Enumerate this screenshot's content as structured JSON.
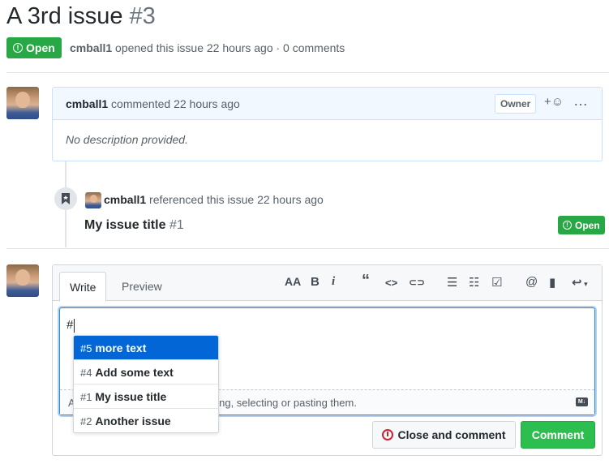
{
  "issue": {
    "title": "A 3rd issue",
    "number": "#3",
    "state": "Open",
    "author": "cmball1",
    "meta_rest": "opened this issue 22 hours ago · 0 comments"
  },
  "comment": {
    "author": "cmball1",
    "action": "commented 22 hours ago",
    "role": "Owner",
    "body": "No description provided."
  },
  "reference": {
    "author": "cmball1",
    "action": "referenced this issue 22 hours ago",
    "issue_title": "My issue title",
    "issue_number": "#1",
    "state": "Open"
  },
  "editor": {
    "tab_write": "Write",
    "tab_preview": "Preview",
    "toolbar": {
      "heading": "AA",
      "bold": "B",
      "italic": "i",
      "quote": "“",
      "code": "<>",
      "link": "⊂⊃",
      "ul": "☰",
      "ol": "☷",
      "task": "☑",
      "mention": "@",
      "reference": "▮",
      "reply": "↩"
    },
    "text_value": "#",
    "drop_hint_prefix": "A",
    "drop_hint": "ping, selecting or pasting them."
  },
  "suggestions": [
    {
      "number": "#5",
      "title": "more text",
      "selected": true
    },
    {
      "number": "#4",
      "title": "Add some text",
      "selected": false
    },
    {
      "number": "#1",
      "title": "My issue title",
      "selected": false
    },
    {
      "number": "#2",
      "title": "Another issue",
      "selected": false
    }
  ],
  "buttons": {
    "close": "Close and comment",
    "comment": "Comment"
  },
  "icons": {
    "open_state": "issue-opened-icon",
    "reaction": "smiley-icon",
    "more": "kebab-horizontal-icon",
    "bookmark": "bookmark-icon",
    "markdown": "markdown-icon",
    "close_issue": "issue-closed-icon"
  },
  "colors": {
    "open_green": "#28a745",
    "comment_green": "#2cbe4e",
    "link_blue": "#0366d6",
    "close_red": "#cb2431"
  }
}
